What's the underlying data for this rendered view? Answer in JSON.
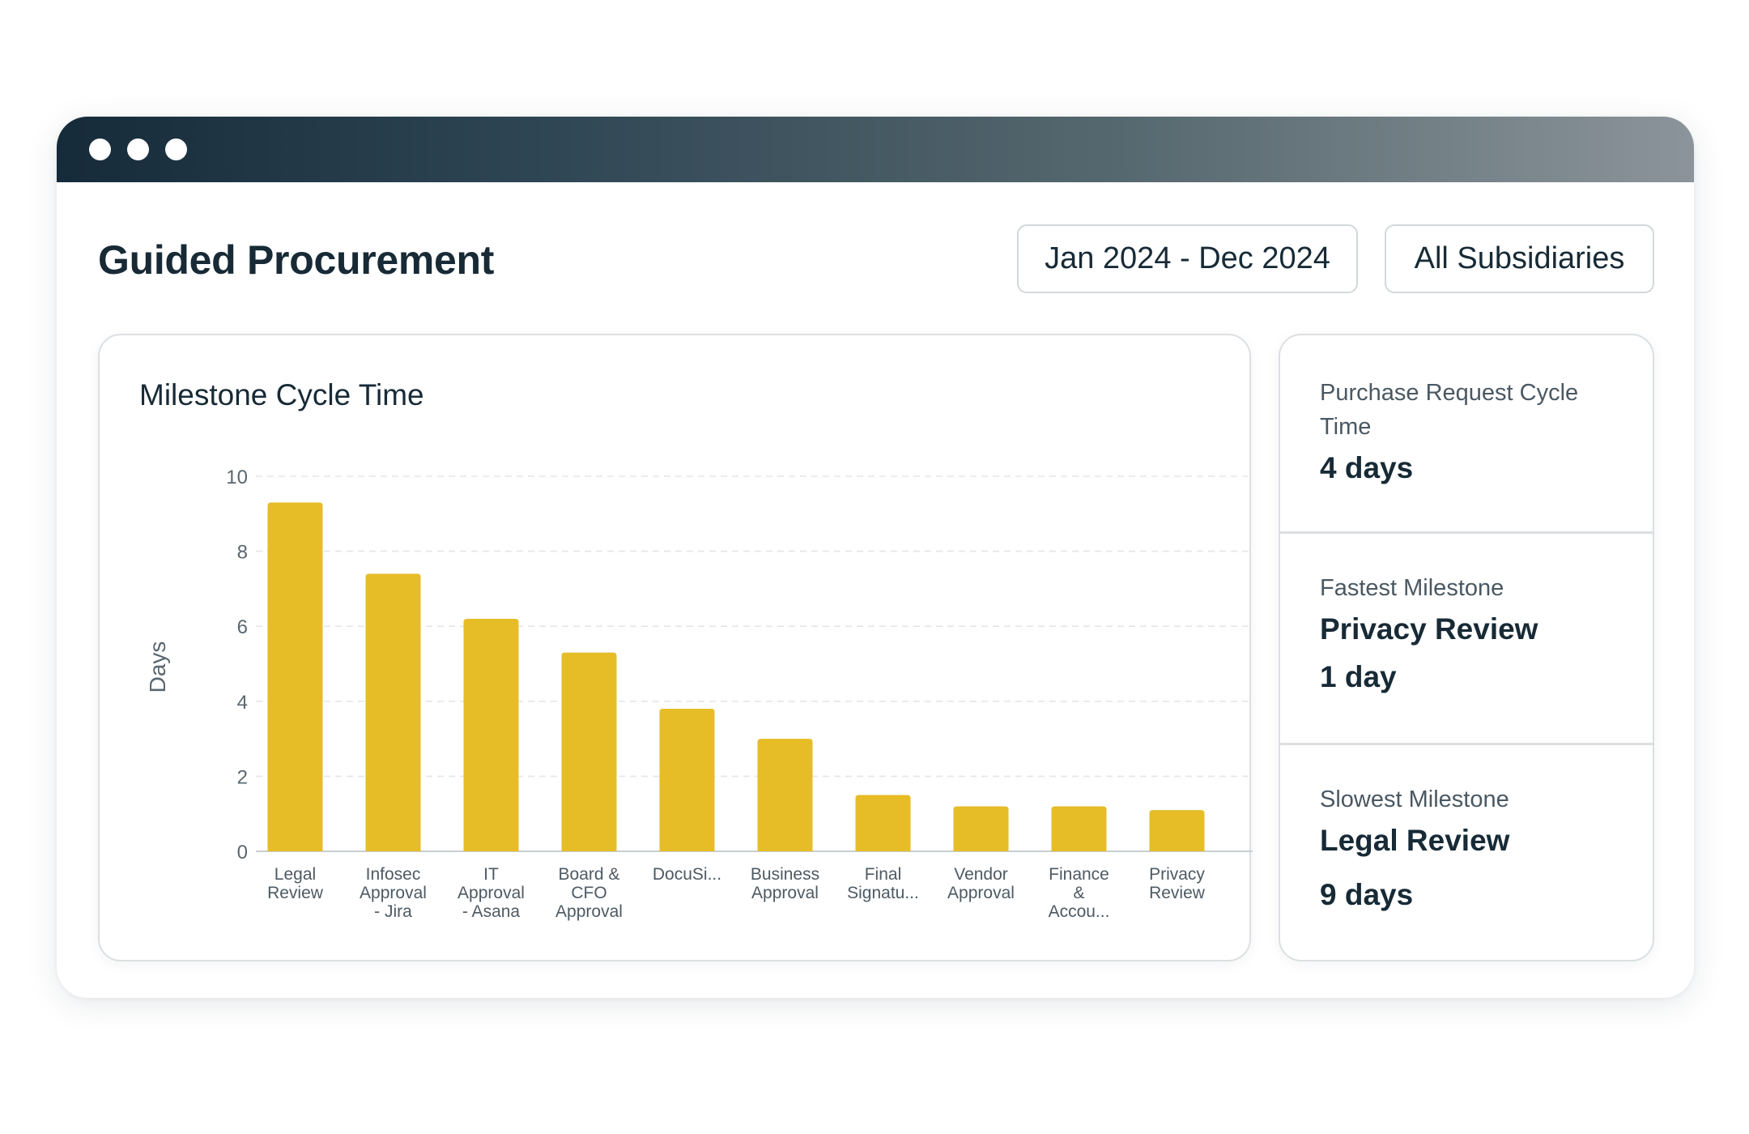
{
  "page": {
    "title": "Guided Procurement",
    "date_filter": "Jan 2024 - Dec 2024",
    "subsidiary_filter": "All Subsidiaries"
  },
  "chart": {
    "title": "Milestone Cycle Time"
  },
  "chart_data": {
    "type": "bar",
    "title": "Milestone Cycle Time",
    "xlabel": "",
    "ylabel": "Days",
    "ylim": [
      0,
      10
    ],
    "yticks": [
      0,
      2,
      4,
      6,
      8,
      10
    ],
    "grid": true,
    "bar_color": "#E6BC27",
    "categories": [
      [
        "Legal",
        "Review"
      ],
      [
        "Infosec",
        "Approval",
        "- Jira"
      ],
      [
        "IT",
        "Approval",
        "- Asana"
      ],
      [
        "Board &",
        "CFO",
        "Approval"
      ],
      [
        "DocuSi..."
      ],
      [
        "Business",
        "Approval"
      ],
      [
        "Final",
        "Signatu..."
      ],
      [
        "Vendor",
        "Approval"
      ],
      [
        "Finance",
        "&",
        "Accou..."
      ],
      [
        "Privacy",
        "Review"
      ]
    ],
    "values": [
      9.3,
      7.4,
      6.2,
      5.3,
      3.8,
      3.0,
      1.5,
      1.2,
      1.2,
      1.1
    ]
  },
  "stats": {
    "cycle_label": "Purchase Request Cycle Time",
    "cycle_value": "4 days",
    "fastest_label": "Fastest Milestone",
    "fastest_name": "Privacy Review",
    "fastest_value": "1 day",
    "slowest_label": "Slowest Milestone",
    "slowest_name": "Legal Review",
    "slowest_value": "9 days"
  },
  "colors": {
    "accent": "#E6BC27",
    "text_dark": "#172A36",
    "border": "#DCDFE2"
  }
}
